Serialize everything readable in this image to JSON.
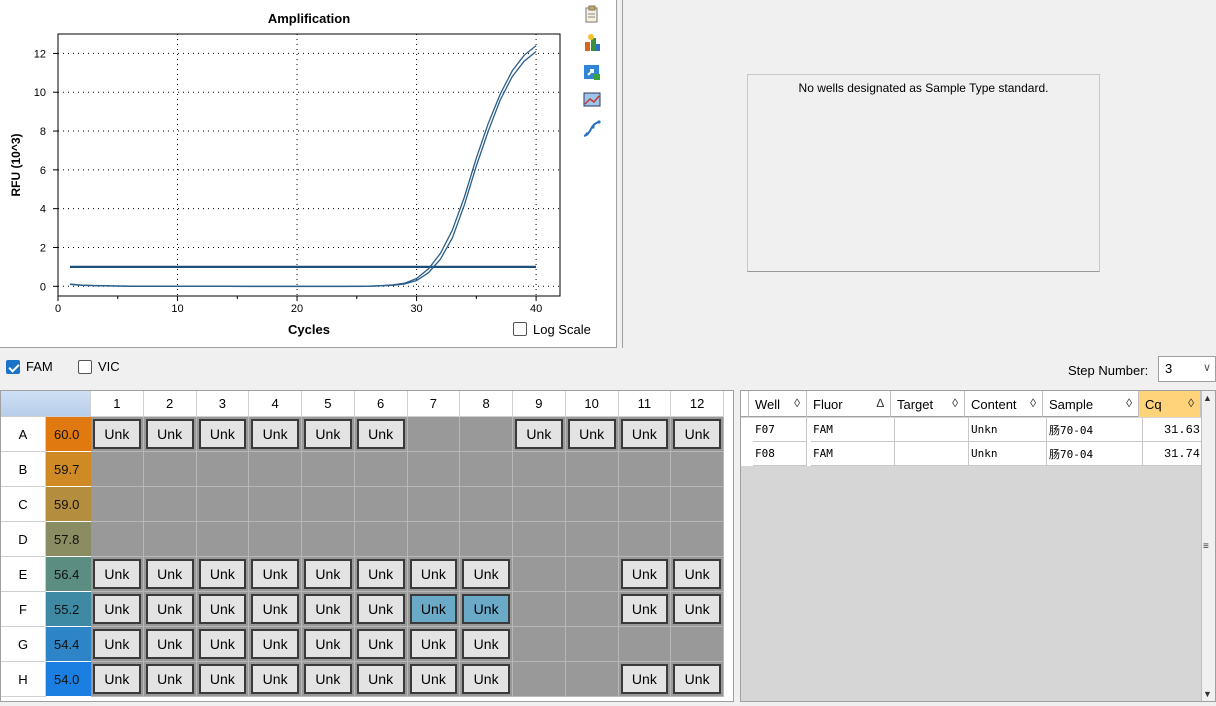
{
  "chart": {
    "title": "Amplification",
    "xlabel": "Cycles",
    "ylabel": "RFU (10^3)",
    "log_scale_label": "Log Scale",
    "log_scale_checked": false
  },
  "chart_data": {
    "type": "line",
    "title": "Amplification",
    "xlabel": "Cycles",
    "ylabel": "RFU (10^3)",
    "xlim": [
      0,
      42
    ],
    "ylim": [
      -0.5,
      13
    ],
    "xticks": [
      0,
      10,
      20,
      30,
      40
    ],
    "yticks": [
      0,
      2,
      4,
      6,
      8,
      10,
      12
    ],
    "grid": true,
    "threshold": 1.0,
    "series": [
      {
        "x": [
          1,
          2,
          3,
          4,
          5,
          6,
          8,
          10,
          12,
          14,
          16,
          18,
          20,
          22,
          24,
          26,
          27,
          28,
          29,
          30,
          31,
          32,
          33,
          34,
          35,
          36,
          37,
          38,
          39,
          40
        ],
        "y": [
          0.1,
          0.05,
          0.03,
          0.02,
          0.01,
          0.0,
          0.0,
          0.0,
          0.0,
          0.0,
          -0.01,
          -0.01,
          -0.01,
          -0.01,
          -0.01,
          0.0,
          0.02,
          0.05,
          0.12,
          0.3,
          0.7,
          1.4,
          2.5,
          4.2,
          6.2,
          8.0,
          9.6,
          10.8,
          11.6,
          12.1
        ]
      },
      {
        "x": [
          1,
          2,
          3,
          4,
          5,
          6,
          8,
          10,
          12,
          14,
          16,
          18,
          20,
          22,
          24,
          26,
          27,
          28,
          29,
          30,
          31,
          32,
          33,
          34,
          35,
          36,
          37,
          38,
          39,
          40
        ],
        "y": [
          0.12,
          0.06,
          0.04,
          0.03,
          0.02,
          0.01,
          0.01,
          0.0,
          0.0,
          0.0,
          0.0,
          0.0,
          0.0,
          0.0,
          0.0,
          0.01,
          0.03,
          0.07,
          0.16,
          0.4,
          0.9,
          1.7,
          2.9,
          4.6,
          6.6,
          8.4,
          9.9,
          11.1,
          11.9,
          12.4
        ]
      }
    ]
  },
  "standard_curve": {
    "message": "No wells designated as Sample Type standard."
  },
  "fluors": [
    {
      "label": "FAM",
      "checked": true
    },
    {
      "label": "VIC",
      "checked": false
    }
  ],
  "step": {
    "label": "Step Number:",
    "value": "3"
  },
  "plate": {
    "columns": [
      "1",
      "2",
      "3",
      "4",
      "5",
      "6",
      "7",
      "8",
      "9",
      "10",
      "11",
      "12"
    ],
    "rows": [
      {
        "label": "A",
        "temp": "60.0",
        "color": "#e07a10",
        "wells": [
          "Unk",
          "Unk",
          "Unk",
          "Unk",
          "Unk",
          "Unk",
          "",
          "",
          "Unk",
          "Unk",
          "Unk",
          "Unk"
        ]
      },
      {
        "label": "B",
        "temp": "59.7",
        "color": "#cf8a25",
        "wells": [
          "",
          "",
          "",
          "",
          "",
          "",
          "",
          "",
          "",
          "",
          "",
          ""
        ]
      },
      {
        "label": "C",
        "temp": "59.0",
        "color": "#b58d3f",
        "wells": [
          "",
          "",
          "",
          "",
          "",
          "",
          "",
          "",
          "",
          "",
          "",
          ""
        ]
      },
      {
        "label": "D",
        "temp": "57.8",
        "color": "#8a8c61",
        "wells": [
          "",
          "",
          "",
          "",
          "",
          "",
          "",
          "",
          "",
          "",
          "",
          ""
        ]
      },
      {
        "label": "E",
        "temp": "56.4",
        "color": "#5b8d80",
        "wells": [
          "Unk",
          "Unk",
          "Unk",
          "Unk",
          "Unk",
          "Unk",
          "Unk",
          "Unk",
          "",
          "",
          "Unk",
          "Unk"
        ]
      },
      {
        "label": "F",
        "temp": "55.2",
        "color": "#3e8aa5",
        "wells": [
          "Unk",
          "Unk",
          "Unk",
          "Unk",
          "Unk",
          "Unk",
          "Unk",
          "Unk",
          "",
          "",
          "Unk",
          "Unk"
        ],
        "selected": [
          6,
          7
        ]
      },
      {
        "label": "G",
        "temp": "54.4",
        "color": "#2d84c6",
        "wells": [
          "Unk",
          "Unk",
          "Unk",
          "Unk",
          "Unk",
          "Unk",
          "Unk",
          "Unk",
          "",
          "",
          "",
          ""
        ]
      },
      {
        "label": "H",
        "temp": "54.0",
        "color": "#1a7fe0",
        "wells": [
          "Unk",
          "Unk",
          "Unk",
          "Unk",
          "Unk",
          "Unk",
          "Unk",
          "Unk",
          "",
          "",
          "Unk",
          "Unk"
        ]
      }
    ]
  },
  "results": {
    "headers": [
      "Well",
      "Fluor",
      "Target",
      "Content",
      "Sample",
      "Cq"
    ],
    "sort_glyphs": [
      "◊",
      "∆",
      "◊",
      "◊",
      "◊",
      "◊"
    ],
    "rows": [
      {
        "well": "F07",
        "fluor": "FAM",
        "target": "",
        "content": "Unkn",
        "sample": "肠70-04",
        "cq": "31.63"
      },
      {
        "well": "F08",
        "fluor": "FAM",
        "target": "",
        "content": "Unkn",
        "sample": "肠70-04",
        "cq": "31.74"
      }
    ]
  },
  "colors": {
    "accent": "#1a73c7",
    "curve": "#1d4f7a",
    "cq_header": "#ffd37a",
    "empty_well": "#999999"
  }
}
